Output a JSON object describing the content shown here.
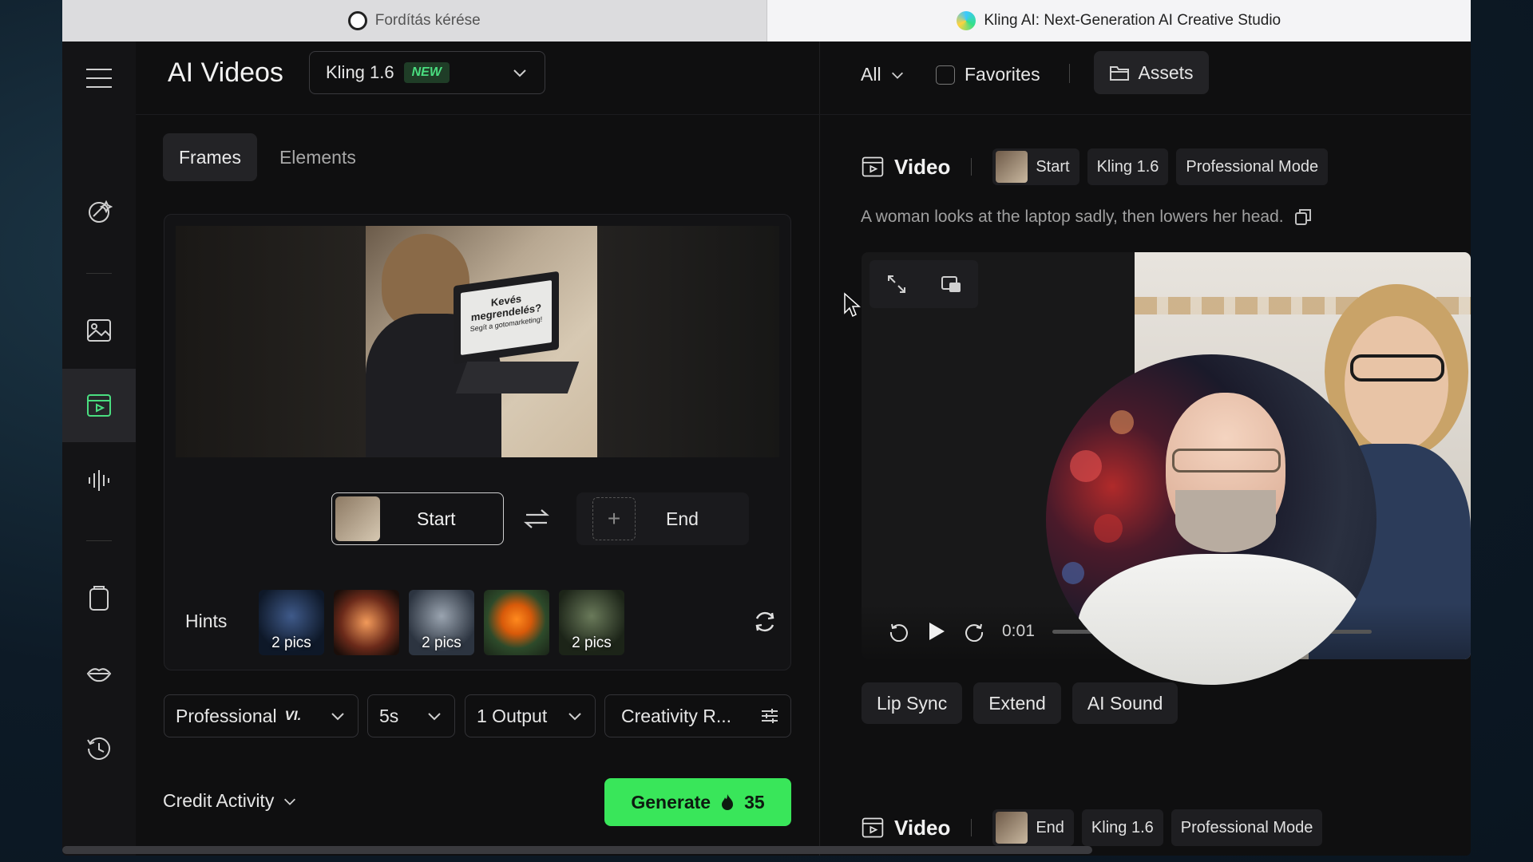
{
  "browser": {
    "tabs": [
      {
        "title": "Fordítás kérése",
        "icon": "openai-icon",
        "active": false
      },
      {
        "title": "Kling AI: Next-Generation AI Creative Studio",
        "icon": "kling-icon",
        "active": true
      }
    ]
  },
  "rail": {
    "items": [
      "sparkle-brush-icon",
      "image-icon",
      "video-icon",
      "audio-wave-icon",
      "clipboard-icon",
      "lips-icon",
      "history-icon"
    ],
    "active": "video-icon"
  },
  "header": {
    "title": "AI Videos",
    "model": "Kling 1.6",
    "model_badge": "NEW"
  },
  "tabs": [
    "Frames",
    "Elements"
  ],
  "frame_preview": {
    "laptop_text_line1": "Kevés",
    "laptop_text_line2": "megrendelés?",
    "laptop_text_small": "Segít a gotomarketing!"
  },
  "frames": {
    "start_label": "Start",
    "end_label": "End",
    "end_add": "+"
  },
  "hints": {
    "label": "Hints",
    "items": [
      {
        "caption": "2 pics"
      },
      {
        "caption": ""
      },
      {
        "caption": "2 pics"
      },
      {
        "caption": ""
      },
      {
        "caption": "2 pics"
      }
    ]
  },
  "settings": {
    "mode": "Professional",
    "mode_badge": "VI.",
    "duration": "5s",
    "outputs": "1 Output",
    "creativity": "Creativity R..."
  },
  "footer": {
    "credit_activity": "Credit Activity",
    "generate_label": "Generate",
    "generate_cost": "35"
  },
  "right": {
    "filter": "All",
    "favorites": "Favorites",
    "assets": "Assets",
    "video_title": "Video",
    "pills": [
      "Start",
      "Kling 1.6",
      "Professional Mode"
    ],
    "prompt": "A woman looks at the laptop sadly, then lowers her head.",
    "player_time": "0:01",
    "actions": [
      "Lip Sync",
      "Extend",
      "AI Sound"
    ],
    "video2_title": "Video",
    "pills2": [
      "End",
      "Kling 1.6",
      "Professional Mode"
    ]
  },
  "colors": {
    "accent_green": "#39e65a",
    "new_badge_green": "#4ade80",
    "background": "#0f0f10"
  }
}
